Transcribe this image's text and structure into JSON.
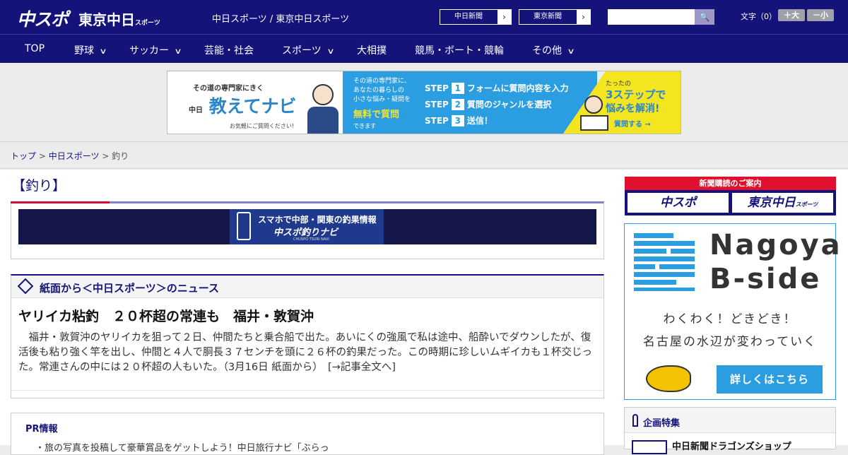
{
  "header": {
    "logo_chuspo": "中スポ",
    "logo_tokyo": "東京中日",
    "logo_tokyo_small": "スポーツ",
    "site_title": "中日スポーツ / 東京中日スポーツ",
    "paper_links": [
      {
        "label": "中日新聞",
        "arrow": "›"
      },
      {
        "label": "東京新聞",
        "arrow": "›"
      }
    ],
    "search": {
      "placeholder": "",
      "button_icon": "search-icon",
      "button_glyph": "🔍"
    },
    "font_size": {
      "label": "文字（0）",
      "bigger": "＋大",
      "smaller": "－小"
    }
  },
  "nav": {
    "items": [
      {
        "label": "TOP",
        "has_dropdown": false
      },
      {
        "label": "野球",
        "has_dropdown": true
      },
      {
        "label": "サッカー",
        "has_dropdown": true
      },
      {
        "label": "芸能・社会",
        "has_dropdown": false
      },
      {
        "label": "スポーツ",
        "has_dropdown": true
      },
      {
        "label": "大相撲",
        "has_dropdown": false
      },
      {
        "label": "競馬・ボート・競輪",
        "has_dropdown": false
      },
      {
        "label": "その他",
        "has_dropdown": true
      }
    ],
    "chevron": "∨"
  },
  "ad_banner": {
    "tagline": "その道の専門家にきく",
    "brand_small": "中日",
    "brand": "教えてナビ",
    "note": "お気軽にご質問ください!",
    "question_lines": [
      "その道の専門家に、",
      "あなたの暮らしの",
      "小さな悩み・疑問を"
    ],
    "free": "無料で質問",
    "can": "できます",
    "steps": [
      {
        "step": "STEP",
        "num": "1",
        "text": "フォームに質問内容を入力"
      },
      {
        "step": "STEP",
        "num": "2",
        "text": "質問のジャンルを選択"
      },
      {
        "step": "STEP",
        "num": "3",
        "text": "送信！"
      }
    ],
    "right_1": "たったの",
    "right_2": "3ステップで",
    "right_3": "悩みを解消!",
    "right_btn": "質問する →"
  },
  "breadcrumb": {
    "items": [
      "トップ",
      "中日スポーツ",
      "釣り"
    ],
    "separator": " > "
  },
  "page_title": "【釣り】",
  "tsuri_banner": {
    "line1": "スマホで中部・関東の釣果情報",
    "line2": "中スポ釣りナビ",
    "line3": "CHUSPO TSURI NAVI"
  },
  "news_section": {
    "title": "紙面から＜中日スポーツ＞のニュース",
    "article_title": "ヤリイカ粘釣　２０杯超の常連も　福井・敦賀沖",
    "article_body": "　福井・敦賀沖のヤリイカを狙って２日、仲間たちと乗合船で出た。あいにくの強風で私は途中、船酔いでダウンしたが、復活後も粘り強く竿を出し、仲間と４人で胴長３７センチを頭に２６杯の釣果だった。この時期に珍しいムギイカも１杯交じった。常連さんの中には２０杯超の人もいた。（3月16日 紙面から）",
    "read_more": "[→記事全文へ]"
  },
  "pr": {
    "heading": "PR情報",
    "text": "・旅の写真を投稿して豪華賞品をゲットしよう！中日旅行ナビ「ぶらっ"
  },
  "sidebar": {
    "subscribe": {
      "title": "新聞購読のご案内",
      "chuspo": "中スポ",
      "tokyo": "東京中日",
      "tokyo_small": "スポーツ"
    },
    "nagoya": {
      "logo_line1": "Nagoya",
      "logo_line2": "B-side",
      "line1": "わくわく！どきどき！",
      "line2": "名古屋の水辺が変わっていく",
      "button": "詳しくはこちら"
    },
    "kikaku": {
      "title": "企画特集",
      "item": "中日新聞ドラゴンズショップ"
    }
  }
}
